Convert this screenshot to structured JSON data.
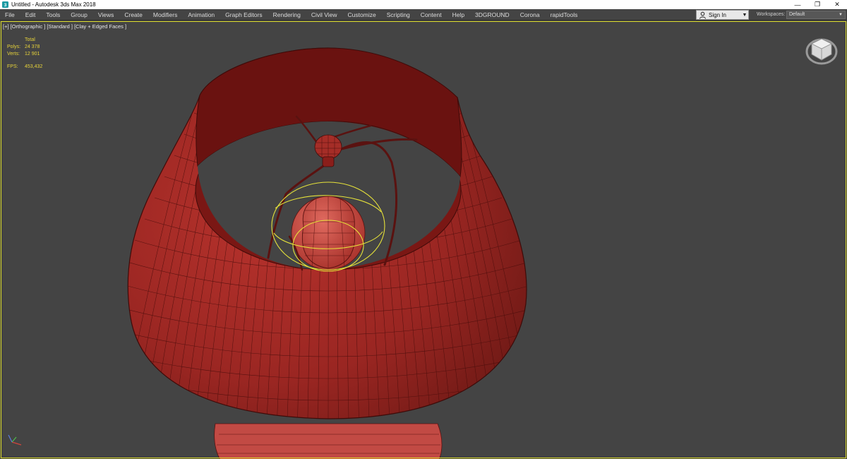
{
  "window": {
    "title": "Untitled - Autodesk 3ds Max 2018",
    "minimize_label": "—",
    "restore_label": "❐",
    "close_label": "✕"
  },
  "menu": [
    {
      "label": "File",
      "id": "file"
    },
    {
      "label": "Edit",
      "id": "edit"
    },
    {
      "label": "Tools",
      "id": "tools"
    },
    {
      "label": "Group",
      "id": "group"
    },
    {
      "label": "Views",
      "id": "views"
    },
    {
      "label": "Create",
      "id": "create"
    },
    {
      "label": "Modifiers",
      "id": "modifiers"
    },
    {
      "label": "Animation",
      "id": "animation"
    },
    {
      "label": "Graph Editors",
      "id": "graph-editors"
    },
    {
      "label": "Rendering",
      "id": "rendering"
    },
    {
      "label": "Civil View",
      "id": "civil-view"
    },
    {
      "label": "Customize",
      "id": "customize"
    },
    {
      "label": "Scripting",
      "id": "scripting"
    },
    {
      "label": "Content",
      "id": "content"
    },
    {
      "label": "Help",
      "id": "help"
    },
    {
      "label": "3DGROUND",
      "id": "3dground"
    },
    {
      "label": "Corona",
      "id": "corona"
    },
    {
      "label": "rapidTools",
      "id": "rapidtools"
    }
  ],
  "account": {
    "signin_label": "Sign In",
    "workspaces_label": "Workspaces:",
    "workspace_value": "Default"
  },
  "viewport": {
    "label": "[+] [Orthographic ] [Standard ] [Clay + Edged Faces ]",
    "stats": {
      "total_label": "Total",
      "polys_label": "Polys:",
      "polys_value": "24 378",
      "verts_label": "Verts:",
      "verts_value": "12 901",
      "fps_label": "FPS:",
      "fps_value": "453,432"
    }
  },
  "colors": {
    "viewport_bg": "#444444",
    "mesh_fill": "#9e2a26",
    "mesh_dark": "#5a1210",
    "selection": "#e6e23a",
    "stats_text": "#e6d23a"
  },
  "icons": {
    "app": "3ds-max-logo-icon",
    "user": "person-icon",
    "dropdown": "chevron-down-icon",
    "viewcube": "viewcube-icon",
    "axis": "axis-tripod-icon"
  }
}
